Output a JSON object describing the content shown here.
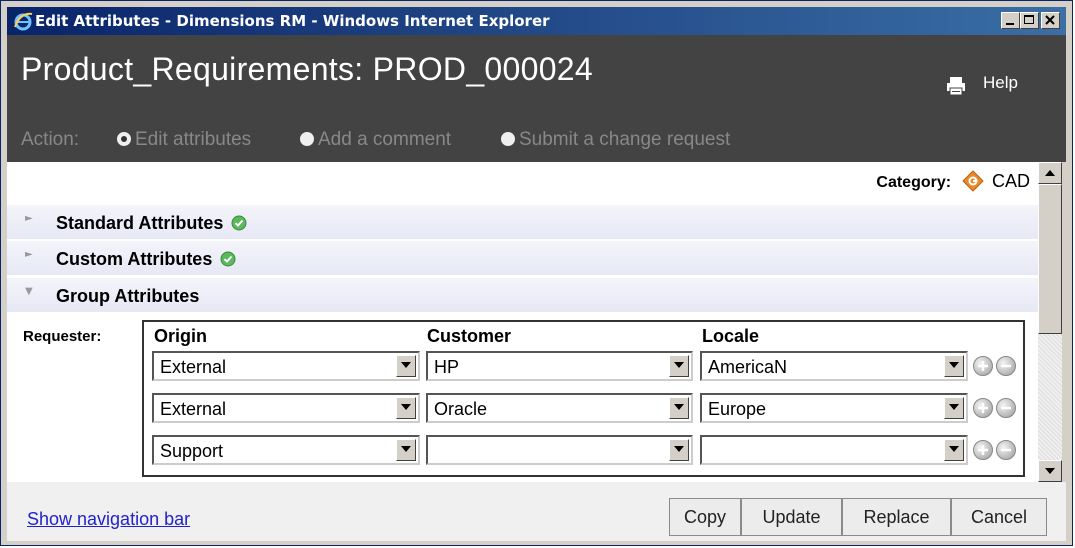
{
  "window": {
    "title": "Edit Attributes - Dimensions RM - Windows Internet Explorer",
    "controls": [
      "minimize",
      "maximize",
      "close"
    ]
  },
  "header": {
    "page_title": "Product_Requirements: PROD_000024",
    "help_label": "Help",
    "print_icon": "print-icon"
  },
  "action": {
    "label": "Action:",
    "options": [
      {
        "label": "Edit attributes",
        "selected": true
      },
      {
        "label": "Add a comment",
        "selected": false
      },
      {
        "label": "Submit a change request",
        "selected": false
      }
    ]
  },
  "category": {
    "label": "Category:",
    "value": "CAD",
    "icon": "cad-diamond-icon"
  },
  "sections": [
    {
      "title": "Standard Attributes",
      "expanded": false,
      "status_icon": "check-circle-icon"
    },
    {
      "title": "Custom Attributes",
      "expanded": false,
      "status_icon": "check-circle-icon"
    },
    {
      "title": "Group Attributes",
      "expanded": true
    }
  ],
  "group": {
    "label": "Requester:",
    "columns": [
      "Origin",
      "Customer",
      "Locale"
    ],
    "rows": [
      {
        "origin": "External",
        "customer": "HP",
        "locale": "AmericaN"
      },
      {
        "origin": "External",
        "customer": "Oracle",
        "locale": "Europe"
      },
      {
        "origin": "Support",
        "customer": "",
        "locale": ""
      }
    ]
  },
  "footer": {
    "nav_link": "Show navigation bar",
    "buttons": [
      "Copy",
      "Update",
      "Replace",
      "Cancel"
    ]
  },
  "colors": {
    "header_bg": "#434343",
    "titlebar_start": "#0a246a",
    "titlebar_end": "#3a6ea5",
    "link": "#2222cc",
    "ok_green": "#5cb85c",
    "cad_orange": "#e8892a"
  }
}
